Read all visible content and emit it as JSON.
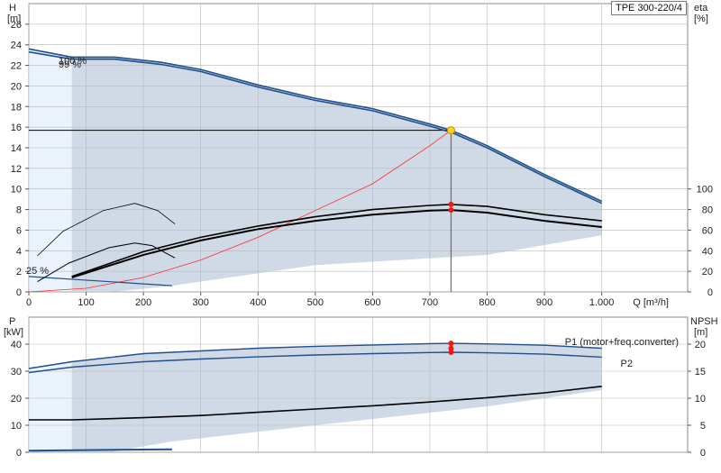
{
  "chart_data": [
    {
      "type": "line",
      "model": "TPE 300-220/4",
      "xlabel": "Q [m³/h]",
      "xlim": [
        0,
        1150
      ],
      "x_ticks": [
        "0",
        "100",
        "200",
        "300",
        "400",
        "500",
        "600",
        "700",
        "800",
        "900",
        "1.000"
      ],
      "left_axis": {
        "label_line1": "H",
        "label_line2": "[m]",
        "ylim": [
          0,
          28
        ],
        "ticks": [
          "0",
          "2",
          "4",
          "6",
          "8",
          "10",
          "12",
          "14",
          "16",
          "18",
          "20",
          "22",
          "24",
          "26"
        ]
      },
      "right_axis": {
        "label_line1": "eta",
        "label_line2": "[%]",
        "ticks": [
          "0",
          "20",
          "40",
          "60",
          "80",
          "100"
        ]
      },
      "curve_labels": [
        "100 %",
        "99 %",
        "25 %"
      ],
      "head_100": [
        [
          0,
          23.6
        ],
        [
          75,
          22.8
        ],
        [
          150,
          22.8
        ],
        [
          230,
          22.3
        ],
        [
          300,
          21.6
        ],
        [
          400,
          20.1
        ],
        [
          500,
          18.8
        ],
        [
          600,
          17.8
        ],
        [
          700,
          16.3
        ],
        [
          737,
          15.7
        ],
        [
          800,
          14.2
        ],
        [
          900,
          11.4
        ],
        [
          1000,
          8.8
        ]
      ],
      "head_99": [
        [
          0,
          23.3
        ],
        [
          75,
          22.6
        ],
        [
          150,
          22.6
        ],
        [
          230,
          22.1
        ],
        [
          300,
          21.4
        ],
        [
          400,
          19.9
        ],
        [
          500,
          18.6
        ],
        [
          600,
          17.6
        ],
        [
          700,
          16.1
        ],
        [
          737,
          15.5
        ],
        [
          800,
          14.0
        ],
        [
          900,
          11.2
        ],
        [
          1000,
          8.6
        ]
      ],
      "head_min": [
        [
          0,
          1.5
        ],
        [
          250,
          0.6
        ]
      ],
      "eta_upper": [
        [
          75,
          1.5
        ],
        [
          200,
          3.9
        ],
        [
          300,
          5.3
        ],
        [
          400,
          6.4
        ],
        [
          500,
          7.3
        ],
        [
          600,
          8.0
        ],
        [
          700,
          8.4
        ],
        [
          737,
          8.5
        ],
        [
          800,
          8.3
        ],
        [
          900,
          7.5
        ],
        [
          1000,
          6.9
        ]
      ],
      "eta_lower": [
        [
          75,
          1.4
        ],
        [
          200,
          3.6
        ],
        [
          300,
          5.0
        ],
        [
          400,
          6.1
        ],
        [
          500,
          6.9
        ],
        [
          600,
          7.5
        ],
        [
          700,
          7.9
        ],
        [
          737,
          7.95
        ],
        [
          800,
          7.7
        ],
        [
          900,
          6.9
        ],
        [
          1000,
          6.3
        ]
      ],
      "eta_small_a": [
        [
          15,
          3.5
        ],
        [
          60,
          5.9
        ],
        [
          130,
          7.9
        ],
        [
          185,
          8.6
        ],
        [
          225,
          7.9
        ],
        [
          255,
          6.6
        ]
      ],
      "eta_small_b": [
        [
          15,
          1.0
        ],
        [
          70,
          2.8
        ],
        [
          140,
          4.3
        ],
        [
          185,
          4.75
        ],
        [
          215,
          4.5
        ],
        [
          255,
          3.3
        ]
      ],
      "system_curve": [
        [
          0,
          0
        ],
        [
          100,
          0.35
        ],
        [
          200,
          1.4
        ],
        [
          300,
          3.1
        ],
        [
          400,
          5.3
        ],
        [
          500,
          7.9
        ],
        [
          600,
          10.5
        ],
        [
          700,
          14.2
        ],
        [
          737,
          15.7
        ]
      ],
      "envelope_min": [
        [
          0,
          0
        ],
        [
          250,
          0.6
        ],
        [
          500,
          2.6
        ],
        [
          800,
          3.6
        ],
        [
          1000,
          5.5
        ]
      ],
      "duty_point": {
        "q": 737,
        "h": 15.7
      },
      "eta_duty_points": [
        8.5,
        7.95
      ],
      "colors": {
        "curve": "#1f4f8c",
        "system": "#ff2a2a",
        "fill": "#cfdae6",
        "fill_light": "#eaf3fb"
      }
    },
    {
      "type": "line",
      "xlim": [
        0,
        1150
      ],
      "left_axis": {
        "label_line1": "P",
        "label_line2": "[kW]",
        "ylim": [
          0,
          50
        ],
        "ticks": [
          "0",
          "10",
          "20",
          "30",
          "40"
        ]
      },
      "right_axis": {
        "label_line1": "NPSH",
        "label_line2": "[m]",
        "ylim": [
          0,
          25
        ],
        "ticks": [
          "0",
          "5",
          "10",
          "15",
          "20"
        ]
      },
      "series": [
        {
          "name": "P1 (motor+freq.converter)",
          "values": [
            [
              0,
              31.0
            ],
            [
              75,
              33.5
            ],
            [
              200,
              36.5
            ],
            [
              300,
              37.5
            ],
            [
              400,
              38.5
            ],
            [
              500,
              39.2
            ],
            [
              600,
              39.7
            ],
            [
              700,
              40.2
            ],
            [
              737,
              40.3
            ],
            [
              800,
              40.1
            ],
            [
              900,
              39.6
            ],
            [
              1000,
              38.5
            ]
          ]
        },
        {
          "name": "P2",
          "values": [
            [
              0,
              29.5
            ],
            [
              75,
              31.5
            ],
            [
              200,
              33.5
            ],
            [
              300,
              34.5
            ],
            [
              400,
              35.3
            ],
            [
              500,
              36.0
            ],
            [
              600,
              36.5
            ],
            [
              700,
              36.9
            ],
            [
              737,
              37.0
            ],
            [
              800,
              36.8
            ],
            [
              900,
              36.3
            ],
            [
              1000,
              35.2
            ]
          ]
        }
      ],
      "npsh": [
        [
          0,
          6
        ],
        [
          75,
          6
        ],
        [
          200,
          6.4
        ],
        [
          300,
          6.8
        ],
        [
          400,
          7.4
        ],
        [
          500,
          8.0
        ],
        [
          600,
          8.6
        ],
        [
          700,
          9.3
        ],
        [
          737,
          9.6
        ],
        [
          800,
          10.1
        ],
        [
          900,
          11.0
        ],
        [
          1000,
          12.2
        ]
      ],
      "p_min": [
        [
          0,
          0.6
        ],
        [
          250,
          1.1
        ]
      ],
      "envelope_min": [
        [
          0,
          0
        ],
        [
          250,
          4
        ],
        [
          500,
          10
        ],
        [
          800,
          17
        ],
        [
          1000,
          23
        ]
      ],
      "duty_points": [
        40.3,
        37.0,
        19.2
      ]
    }
  ]
}
